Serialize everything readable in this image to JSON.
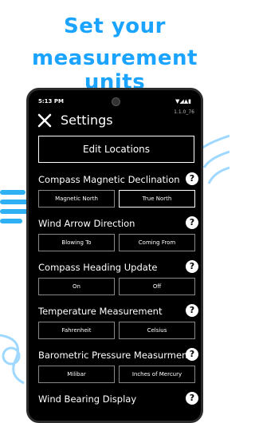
{
  "headline": {
    "line1": "Set your",
    "line2": "measurement units"
  },
  "status_bar": {
    "time": "5:13 PM",
    "icons_text": "▼◢▲▮"
  },
  "version": "1.1.0_76",
  "header": {
    "title": "Settings"
  },
  "edit_locations_label": "Edit Locations",
  "sections": [
    {
      "label": "Compass Magnetic Declination",
      "help": "?",
      "options": [
        "Magnetic North",
        "True North"
      ],
      "selected": 1
    },
    {
      "label": "Wind Arrow Direction",
      "help": "?",
      "options": [
        "Blowing To",
        "Coming From"
      ],
      "selected": null
    },
    {
      "label": "Compass Heading Update",
      "help": "?",
      "options": [
        "On",
        "Off"
      ],
      "selected": null
    },
    {
      "label": "Temperature Measurement",
      "help": "?",
      "options": [
        "Fahrenheit",
        "Celsius"
      ],
      "selected": null
    },
    {
      "label": "Barometric Pressure Measurment",
      "help": "?",
      "options": [
        "Milibar",
        "Inches of Mercury"
      ],
      "selected": null
    },
    {
      "label": "Wind Bearing Display",
      "help": "?",
      "options": [],
      "selected": null
    }
  ],
  "colors": {
    "accent": "#1aa3ff",
    "phone_bg": "#000000",
    "text": "#ffffff"
  }
}
